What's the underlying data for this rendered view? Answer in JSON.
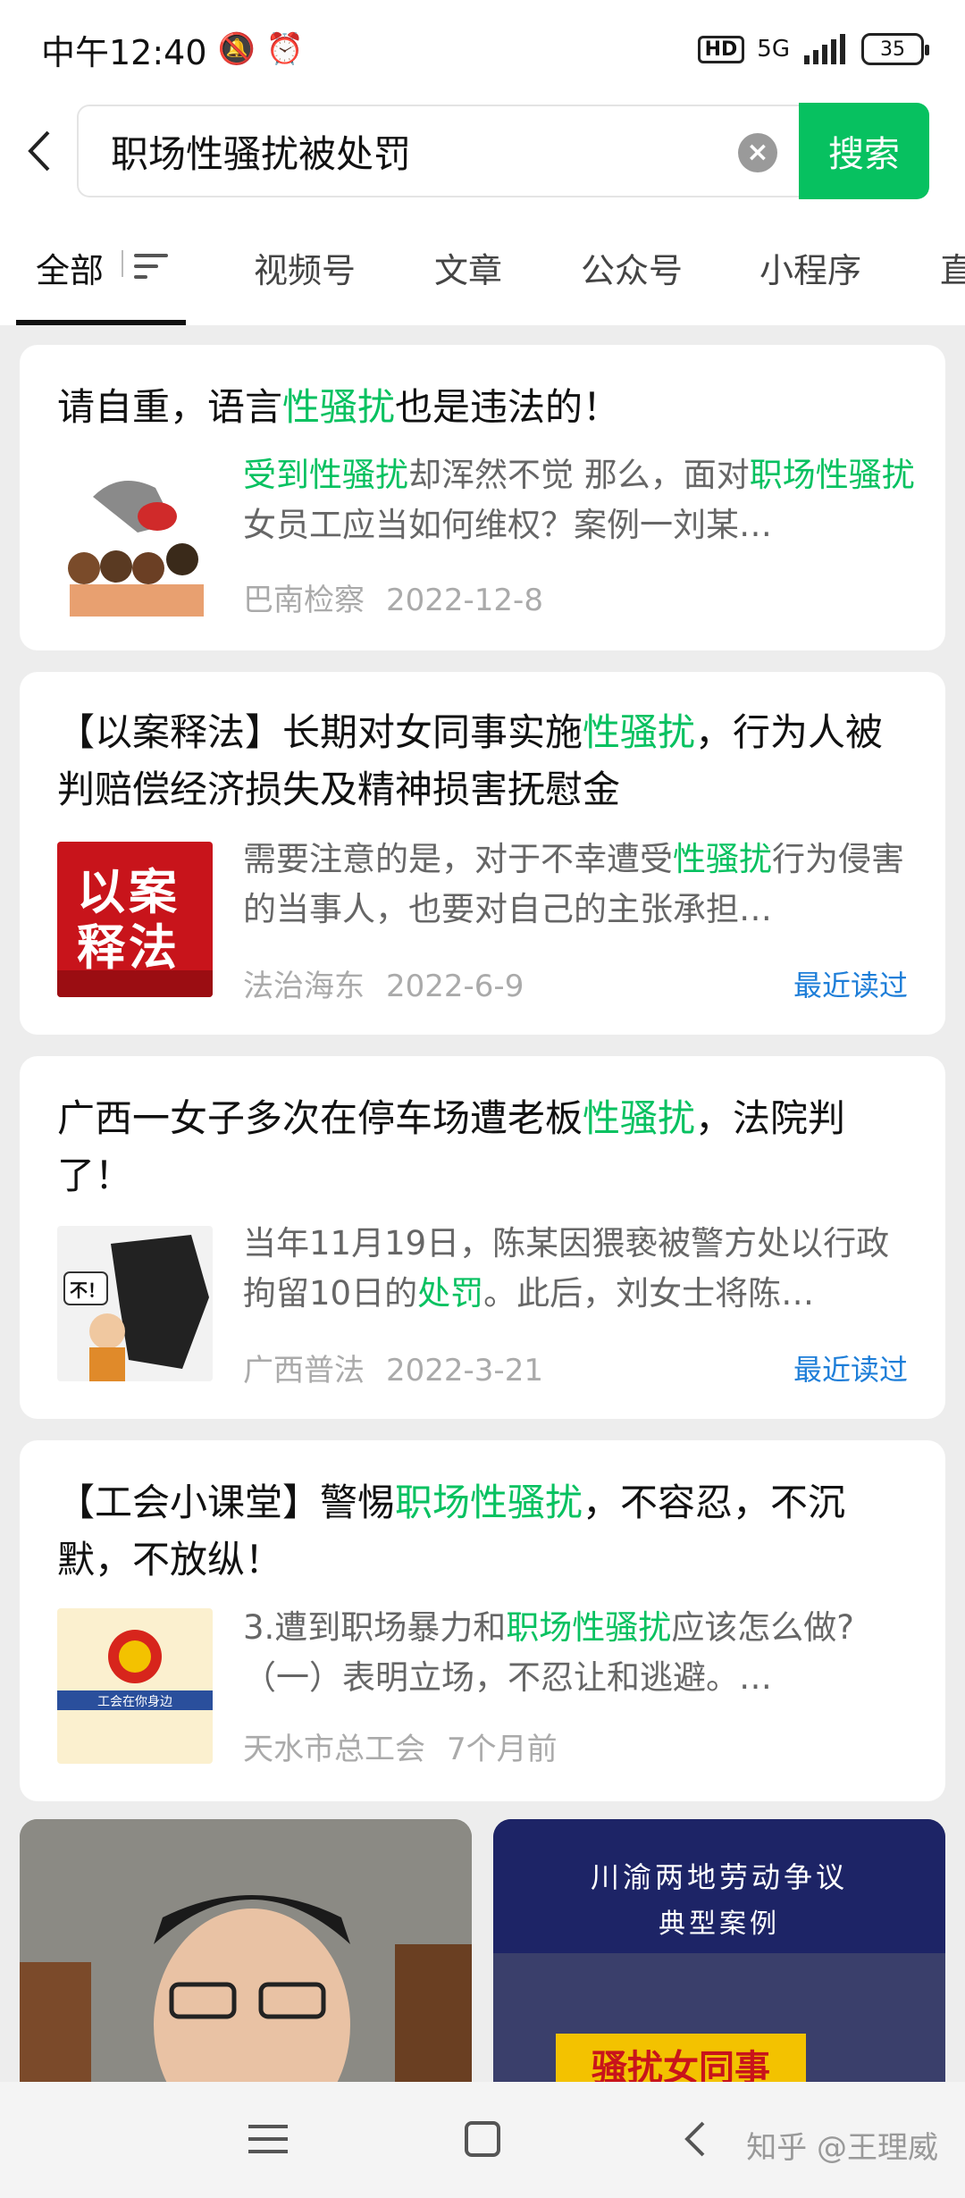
{
  "status": {
    "time": "中午12:40",
    "network": "5G",
    "hd": "HD",
    "battery": "35"
  },
  "search": {
    "query": "职场性骚扰被处罚",
    "button": "搜索"
  },
  "tabs": [
    "全部",
    "视频号",
    "文章",
    "公众号",
    "小程序",
    "直"
  ],
  "results": [
    {
      "title_parts": [
        "请自重，语言",
        "性骚扰",
        "也是违法的！"
      ],
      "snippet_parts": [
        "受到性骚扰",
        "却浑然不觉 那么，面对",
        "职场性骚扰",
        " 女员工应当如何维权？案例一刘某…"
      ],
      "source": "巴南检察",
      "date": "2022-12-8",
      "recent": ""
    },
    {
      "title_parts": [
        "【以案释法】长期对女同事实施",
        "性骚扰",
        "，行为人被判赔偿经济损失及精神损害抚慰金"
      ],
      "snippet_parts": [
        "需要注意的是，对于不幸遭受",
        "性骚扰",
        "行为侵害的当事人，也要对自己的主张承担…"
      ],
      "source": "法治海东",
      "date": "2022-6-9",
      "recent": "最近读过",
      "thumb_text": "以案释法"
    },
    {
      "title_parts": [
        "广西一女子多次在停车场遭老板",
        "性骚扰",
        "，法院判了！"
      ],
      "snippet_parts": [
        "当年11月19日，陈某因猥亵被警方处以行政拘留10日的",
        "处罚",
        "。此后，刘女士将陈…"
      ],
      "source": "广西普法",
      "date": "2022-3-21",
      "recent": "最近读过",
      "thumb_text": "不！"
    },
    {
      "title_parts": [
        "【工会小课堂】警惕",
        "职场性骚扰",
        "，不容忍，不沉默，不放纵！"
      ],
      "snippet_parts": [
        "3.遭到职场暴力和",
        "职场性骚扰",
        "应该怎么做?（一）表明立场，不忍让和逃避。…"
      ],
      "source": "天水市总工会",
      "date": "7个月前",
      "recent": "",
      "thumb_text": "工会在你身边"
    }
  ],
  "videos": [
    {
      "caption": ""
    },
    {
      "caption_line1": "川渝两地劳动争议",
      "caption_line2": "典型案例",
      "caption_bottom": "骚扰女同事"
    }
  ],
  "watermark": "知乎 @王理威"
}
